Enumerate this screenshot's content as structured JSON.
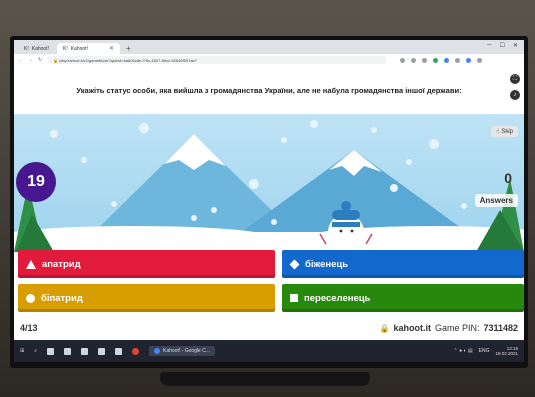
{
  "browser": {
    "tabs": [
      {
        "label": "Kahoot!"
      },
      {
        "label": "Kahoot!"
      }
    ],
    "new_tab": "+",
    "url": "play.kahoot.it/v2/gameblock?quizId=ba606c8e-f75c-4507-89cc-52640f507ae7"
  },
  "question": {
    "text": "Укажіть статус особи, яка вийшла з громадянства України, але не набула громадянства іншої держави:"
  },
  "game": {
    "skip_label": "Skip",
    "timer": "19",
    "answers_count": "0",
    "answers_label": "Answers"
  },
  "answers": [
    {
      "shape": "triangle",
      "label": "апатрид",
      "color": "#e21b3c"
    },
    {
      "shape": "diamond",
      "label": "біженець",
      "color": "#1368ce"
    },
    {
      "shape": "circle",
      "label": "біпатрид",
      "color": "#d89e00"
    },
    {
      "shape": "square",
      "label": "переселенець",
      "color": "#26890c"
    }
  ],
  "footer": {
    "progress": "4/13",
    "site": "kahoot.it",
    "pin_label": "Game PIN:",
    "pin_value": "7311482"
  },
  "taskbar": {
    "app_label": "Kahoot! - Google C...",
    "tray_lang": "ENG",
    "clock_time": "13:15",
    "clock_date": "18.02.2021"
  }
}
